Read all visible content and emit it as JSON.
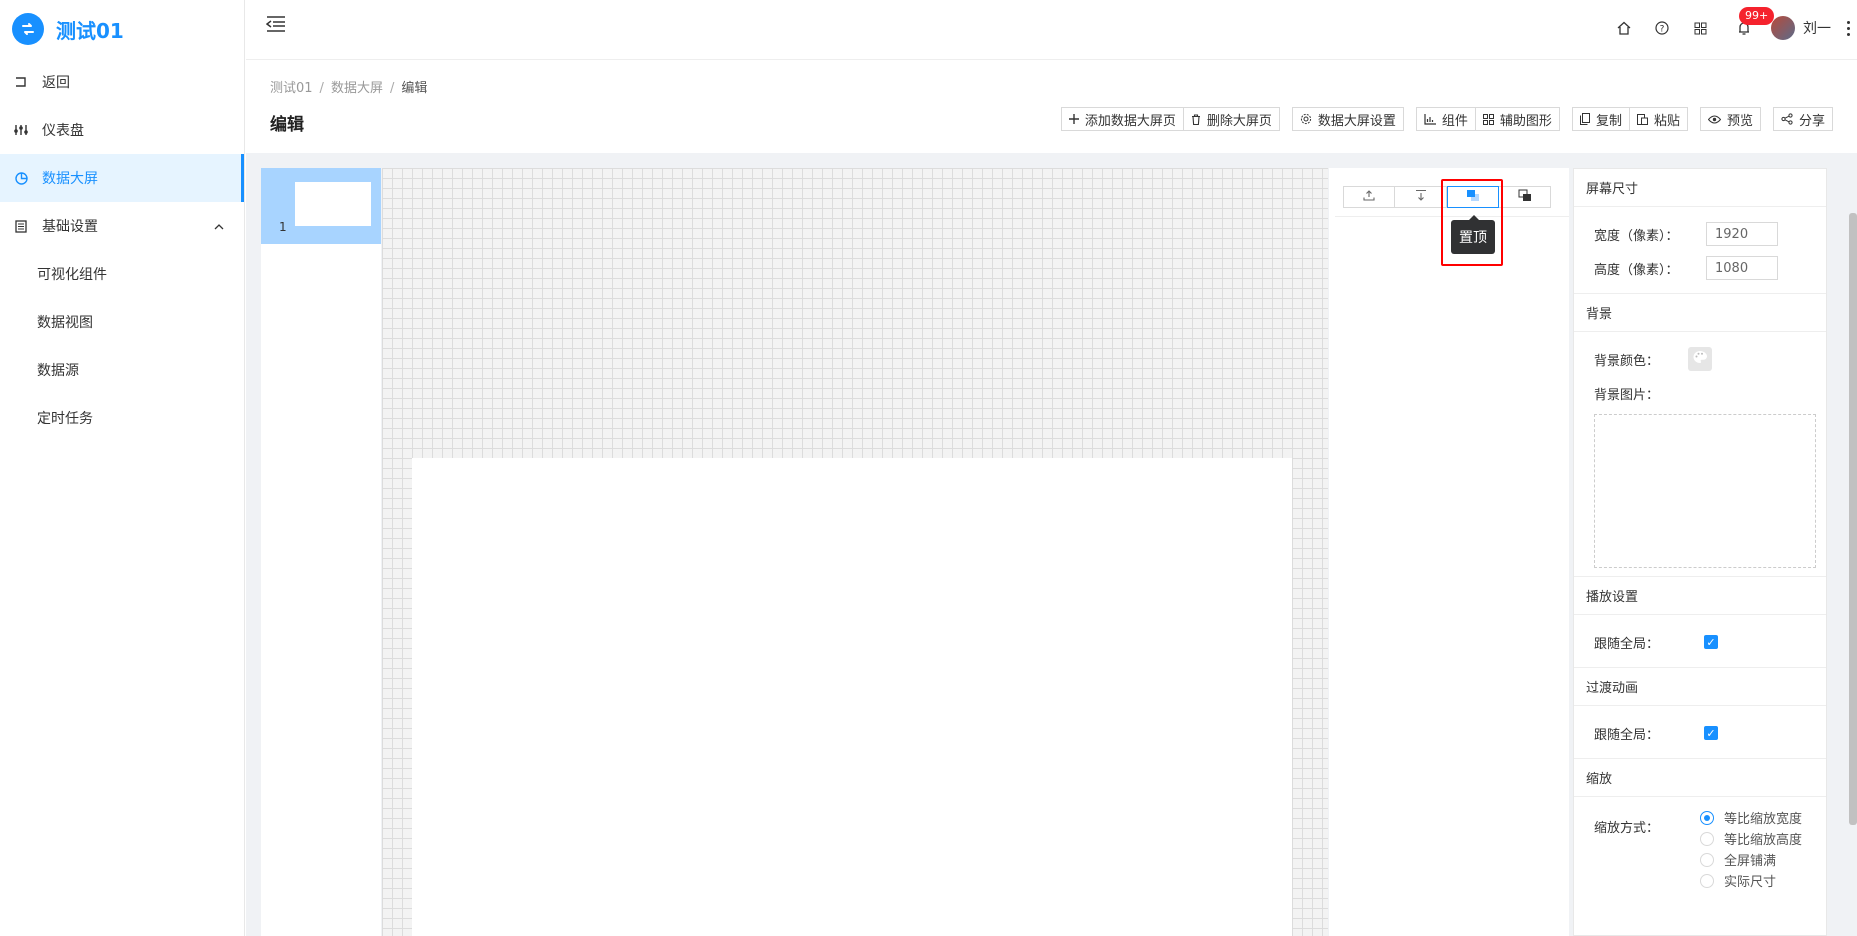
{
  "brand": {
    "title": "测试01"
  },
  "sidebar": {
    "items": [
      {
        "label": "返回",
        "icon": "return-icon"
      },
      {
        "label": "仪表盘",
        "icon": "dashboard-icon"
      },
      {
        "label": "数据大屏",
        "icon": "pie-chart-icon",
        "active": true
      },
      {
        "label": "基础设置",
        "icon": "settings-list-icon",
        "expanded": true
      }
    ],
    "sub_items": [
      {
        "label": "可视化组件"
      },
      {
        "label": "数据视图"
      },
      {
        "label": "数据源"
      },
      {
        "label": "定时任务"
      }
    ]
  },
  "header": {
    "notifications_badge": "99+",
    "username": "刘一"
  },
  "breadcrumb": [
    "测试01",
    "数据大屏",
    "编辑"
  ],
  "page_title": "编辑",
  "toolbar": {
    "add_page": "添加数据大屏页",
    "delete_page": "删除大屏页",
    "screen_settings": "数据大屏设置",
    "components": "组件",
    "aux_shapes": "辅助图形",
    "copy": "复制",
    "paste": "粘贴",
    "preview": "预览",
    "share": "分享"
  },
  "thumbnails": [
    {
      "number": "1"
    }
  ],
  "layer_panel": {
    "tooltip": "置顶"
  },
  "props": {
    "screen_size": {
      "title": "屏幕尺寸",
      "width_label": "宽度（像素）：",
      "width_value": "1920",
      "height_label": "高度（像素）：",
      "height_value": "1080"
    },
    "background": {
      "title": "背景",
      "color_label": "背景颜色：",
      "image_label": "背景图片："
    },
    "playback": {
      "title": "播放设置",
      "follow_label": "跟随全局："
    },
    "transition": {
      "title": "过渡动画",
      "follow_label": "跟随全局："
    },
    "scaling": {
      "title": "缩放",
      "mode_label": "缩放方式：",
      "options": [
        "等比缩放宽度",
        "等比缩放高度",
        "全屏铺满",
        "实际尺寸"
      ],
      "selected": "等比缩放宽度"
    }
  },
  "colors": {
    "accent": "#1890ff",
    "badge": "#f5222d",
    "highlight": "#ff0000"
  }
}
